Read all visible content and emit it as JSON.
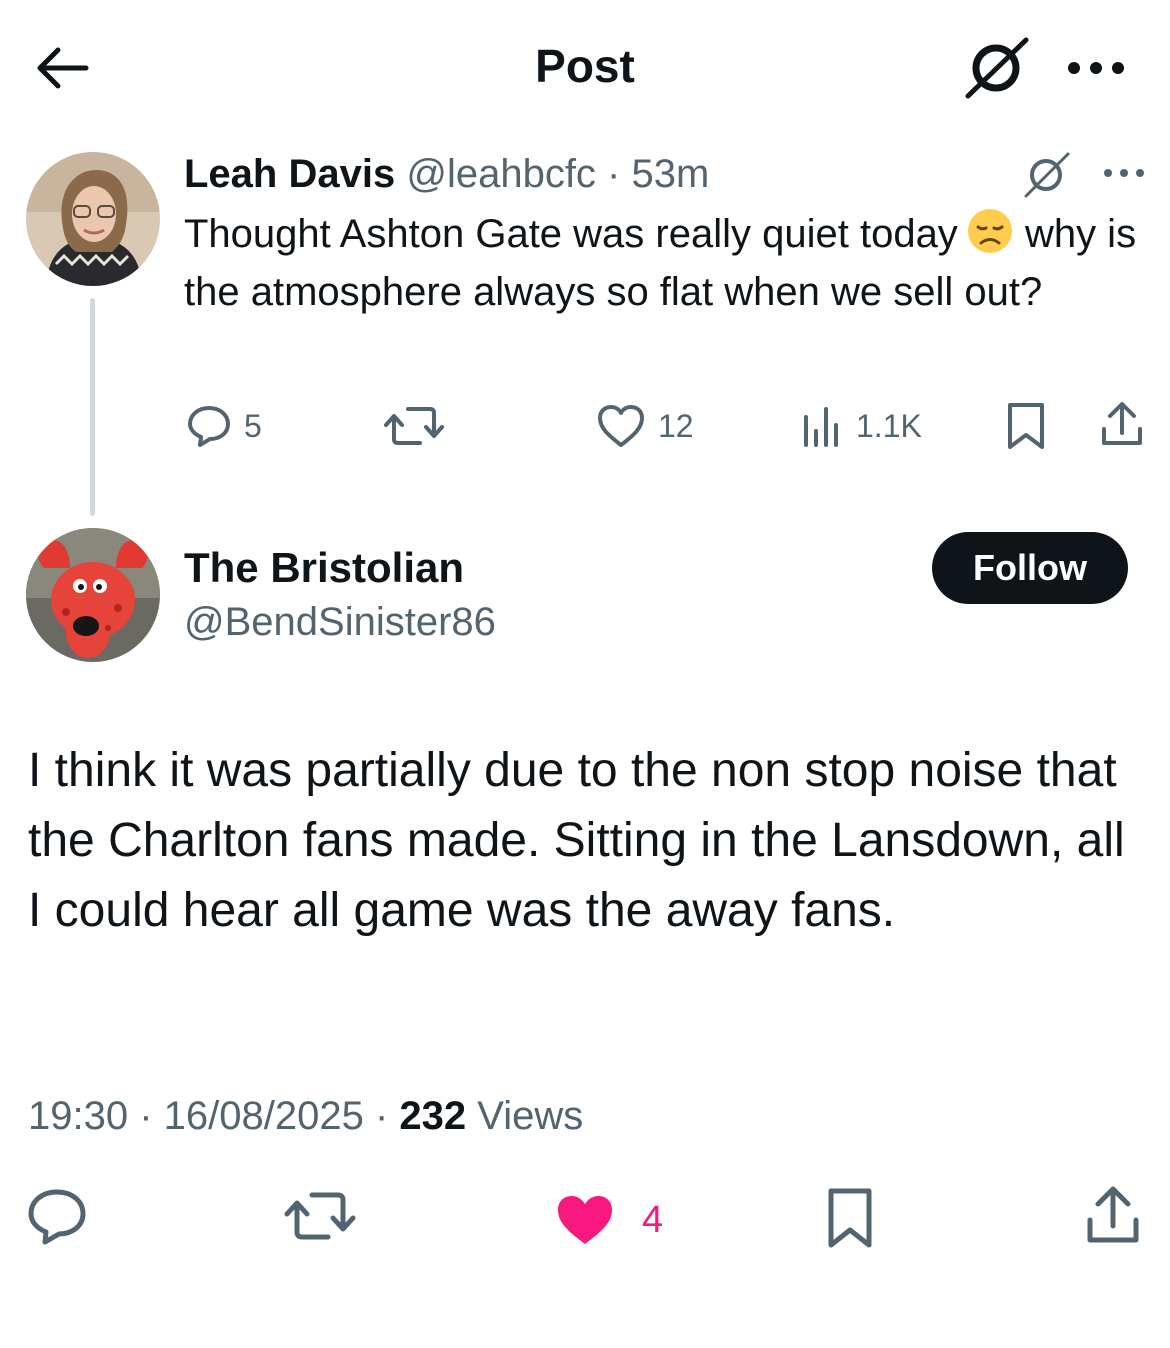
{
  "header": {
    "title": "Post"
  },
  "parent_tweet": {
    "author_name": "Leah Davis",
    "author_handle": "@leahbcfc",
    "separator": " · ",
    "time_ago": "53m",
    "text_line1": "Thought Ashton Gate was really quiet today",
    "text_rest": "why is the atmosphere always so flat when we sell out?",
    "emoji": "disappointed-face",
    "replies": "5",
    "likes": "12",
    "views": "1.1K"
  },
  "main_tweet": {
    "author_name": "The Bristolian",
    "author_handle": "@BendSinister86",
    "follow_label": "Follow",
    "text": "I think it was partially due to the non stop noise that the Charlton fans made. Sitting in the Lansdown, all I could hear all game was the away fans.",
    "time": "19:30",
    "date": "16/08/2025",
    "separator": " · ",
    "views_count": "232",
    "views_label": " Views",
    "likes": "4",
    "liked": true
  },
  "colors": {
    "text_primary": "#0f1419",
    "text_secondary": "#536471",
    "like_active": "#f91880",
    "thread_line": "#cfd9de",
    "follow_bg": "#0f1419"
  },
  "icons": [
    "back-arrow-icon",
    "grok-icon",
    "more-icon",
    "reply-icon",
    "retweet-icon",
    "heart-icon",
    "views-icon",
    "bookmark-icon",
    "share-icon"
  ]
}
